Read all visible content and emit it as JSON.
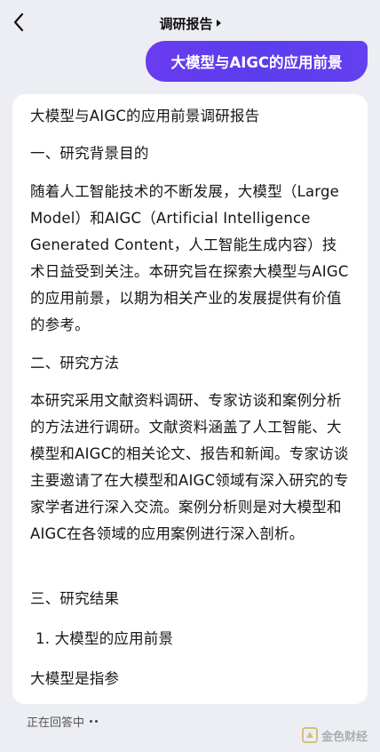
{
  "header": {
    "title": "调研报告"
  },
  "user_message": "大模型与AIGC的应用前景",
  "answer": {
    "p1": "大模型与AIGC的应用前景调研报告",
    "p2": "一、研究背景目的",
    "p3": "随着人工智能技术的不断发展，大模型（Large Model）和AIGC（Artificial Intelligence Generated Content，人工智能生成内容）技术日益受到关注。本研究旨在探索大模型与AIGC的应用前景，以期为相关产业的发展提供有价值的参考。",
    "p4": "二、研究方法",
    "p5": "本研究采用文献资料调研、专家访谈和案例分析的方法进行调研。文献资料涵盖了人工智能、大模型和AIGC的相关论文、报告和新闻。专家访谈主要邀请了在大模型和AIGC领域有深入研究的专家学者进行深入交流。案例分析则是对大模型和AIGC在各领域的应用案例进行深入剖析。",
    "p6": "三、研究结果",
    "p7": "1. 大模型的应用前景",
    "p8": "大模型是指参"
  },
  "status": {
    "text": "正在回答中"
  },
  "watermark": {
    "text": "金色财经"
  },
  "colors": {
    "bubble": "#5b3ded",
    "background": "#eceef3",
    "card": "#ffffff"
  }
}
